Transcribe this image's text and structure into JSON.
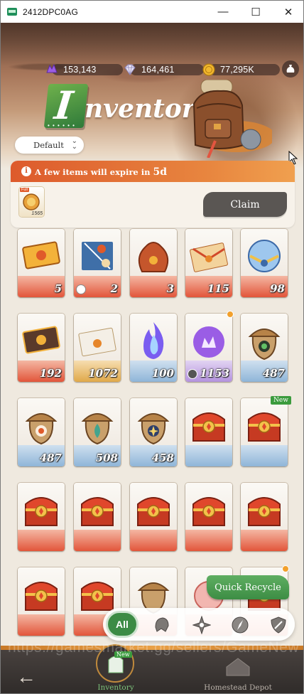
{
  "window": {
    "title": "2412DPC0AG",
    "controls": {
      "minimize": "—",
      "maximize": "☐",
      "close": "✕"
    }
  },
  "currency": [
    {
      "icon": "purple-crystal-icon",
      "value": "153,143"
    },
    {
      "icon": "diamond-icon",
      "value": "164,461"
    },
    {
      "icon": "gold-coin-icon",
      "value": "77,295K"
    }
  ],
  "header": {
    "title_initial": "I",
    "title_rest": "nventory",
    "dots": "• • • • • •"
  },
  "sort": {
    "selected": "Default"
  },
  "expire": {
    "message": "A few items will expire in ",
    "days": "5d",
    "item": {
      "tag": "Full",
      "count": "1565"
    },
    "claim_label": "Claim"
  },
  "items": [
    {
      "art": "ticket-orange-icon",
      "count": "5",
      "theme": "red"
    },
    {
      "art": "map-scroll-icon",
      "count": "2",
      "theme": "red",
      "lock": true
    },
    {
      "art": "sack-icon",
      "count": "3",
      "theme": "red"
    },
    {
      "art": "envelope-gold-icon",
      "count": "115",
      "theme": "red"
    },
    {
      "art": "crystal-orb-icon",
      "count": "98",
      "theme": "red"
    },
    {
      "art": "ticket-dark-icon",
      "count": "192",
      "theme": "red"
    },
    {
      "art": "envelope-white-icon",
      "count": "1072",
      "theme": "gold"
    },
    {
      "art": "flame-blue-icon",
      "count": "100",
      "theme": "blue"
    },
    {
      "art": "flame-purple-icon",
      "count": "1153",
      "theme": "purple",
      "dot": true,
      "plus": true
    },
    {
      "art": "acorn-green-icon",
      "count": "487",
      "theme": "blue"
    },
    {
      "art": "acorn-red-icon",
      "count": "487",
      "theme": "blue"
    },
    {
      "art": "acorn-teal-icon",
      "count": "508",
      "theme": "blue"
    },
    {
      "art": "acorn-star-icon",
      "count": "458",
      "theme": "blue"
    },
    {
      "art": "chest-icon",
      "count": "",
      "theme": "blue"
    },
    {
      "art": "chest-icon",
      "count": "",
      "theme": "blue",
      "new": "New"
    },
    {
      "art": "chest-icon",
      "count": "",
      "theme": "red"
    },
    {
      "art": "chest-icon",
      "count": "",
      "theme": "red"
    },
    {
      "art": "chest-icon",
      "count": "",
      "theme": "red"
    },
    {
      "art": "chest-icon",
      "count": "",
      "theme": "red"
    },
    {
      "art": "chest-icon",
      "count": "",
      "theme": "red"
    },
    {
      "art": "chest-icon",
      "count": "",
      "theme": "red"
    },
    {
      "art": "chest-icon",
      "count": "",
      "theme": "red"
    },
    {
      "art": "acorn-plain-icon",
      "count": "",
      "theme": "red"
    },
    {
      "art": "orb-pink-icon",
      "count": "",
      "theme": "red"
    },
    {
      "art": "chest-icon",
      "count": "",
      "theme": "red"
    }
  ],
  "quick_recycle": {
    "label": "Quick Recycle"
  },
  "filters": {
    "all_label": "All",
    "icons": [
      "helmet-icon",
      "shuriken-icon",
      "compass-icon",
      "shield-icon"
    ]
  },
  "nav": {
    "back": "←",
    "tabs": [
      {
        "label": "Inventory",
        "badge": "New"
      },
      {
        "label": "Homestead Depot"
      }
    ]
  },
  "watermark": "https://gamesmarket.gg/sellers/GameNew"
}
